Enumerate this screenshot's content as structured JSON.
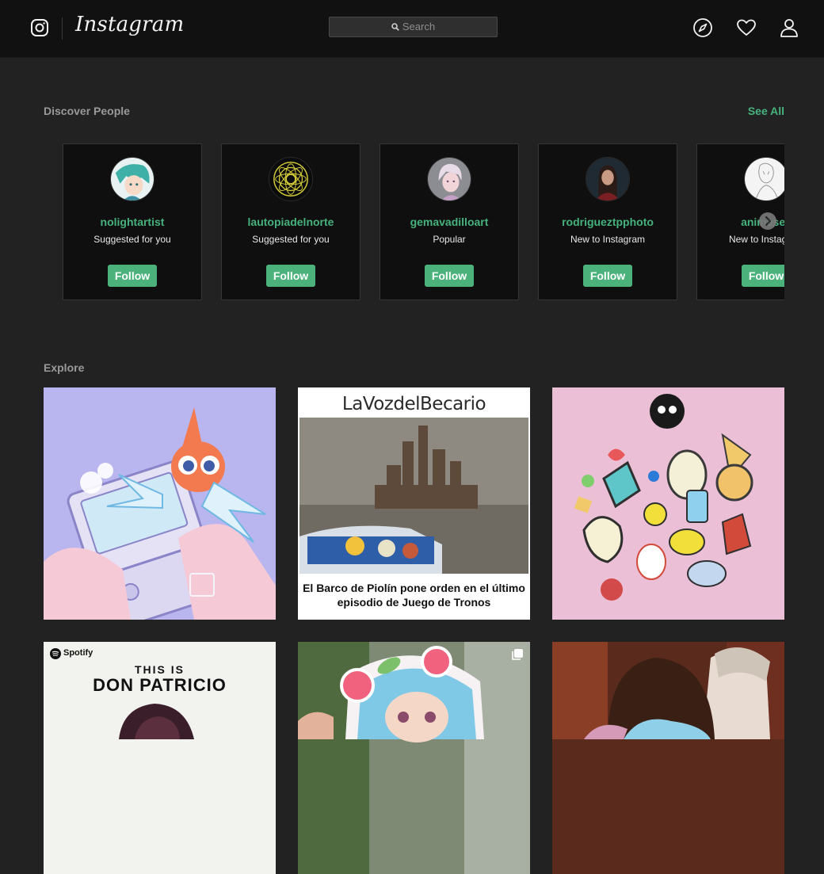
{
  "nav": {
    "logo_text": "Instagram",
    "search_placeholder": "Search",
    "icons": [
      "instagram-glyph-icon",
      "compass-icon",
      "heart-icon",
      "profile-icon"
    ]
  },
  "discover": {
    "title": "Discover People",
    "see_all": "See All",
    "cards": [
      {
        "username": "nolightartist",
        "reason": "Suggested for you",
        "button": "Follow"
      },
      {
        "username": "lautopiadelnorte",
        "reason": "Suggested for you",
        "button": "Follow"
      },
      {
        "username": "gemavadilloart",
        "reason": "Popular",
        "button": "Follow"
      },
      {
        "username": "rodrigueztpphoto",
        "reason": "New to Instagram",
        "button": "Follow"
      },
      {
        "username": "animese_",
        "reason": "New to Instagram",
        "button": "Follow"
      }
    ]
  },
  "explore": {
    "title": "Explore",
    "tiles": [
      {
        "subject": "pokemon-handheld-illustration"
      },
      {
        "subject": "castle-meme",
        "header": "LaVozdelBecario",
        "caption": "El Barco de Piolín pone orden en el último episodio de Juego de Tronos"
      },
      {
        "subject": "enamel-pins"
      },
      {
        "subject": "spotify-playlist",
        "brand": "Spotify",
        "line1": "THIS IS",
        "line2": "DON PATRICIO"
      },
      {
        "subject": "sticker-illustration"
      },
      {
        "subject": "embrace-photo"
      }
    ]
  },
  "colors": {
    "accent": "#46b27d",
    "follow_bg": "#4cb27c",
    "background": "#222222",
    "nav_bg": "#111111"
  }
}
